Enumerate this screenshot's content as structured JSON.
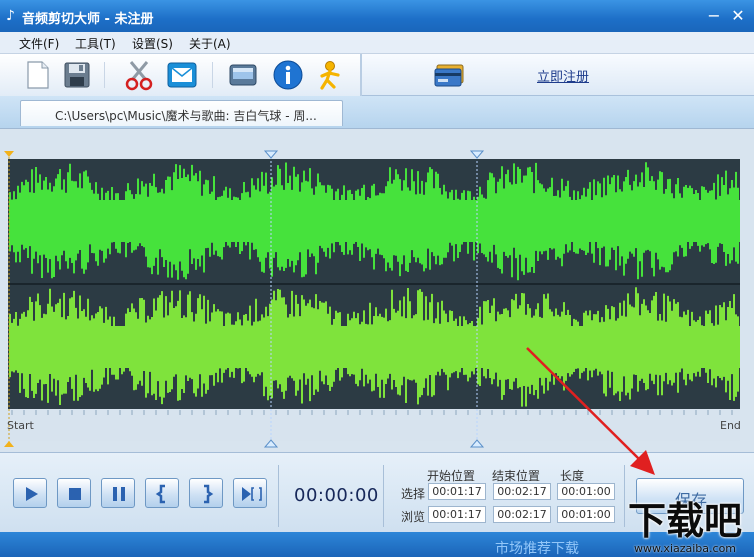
{
  "window": {
    "title": "音频剪切大师 - 未注册",
    "app_icon_glyph": "♪",
    "minimize_glyph": "−",
    "close_glyph": "✕"
  },
  "menu": {
    "items": [
      {
        "label": "文件(F)"
      },
      {
        "label": "工具(T)"
      },
      {
        "label": "设置(S)"
      },
      {
        "label": "关于(A)"
      }
    ]
  },
  "toolbar": {
    "icons": [
      "new-file-icon",
      "save-disk-icon",
      "scissors-icon",
      "mail-icon",
      "monitor-icon",
      "info-icon",
      "runner-icon"
    ],
    "register_label": "立即注册",
    "card_icon": "card-icon"
  },
  "file_tab": {
    "label": "C:\\Users\\pc\\Music\\魔术与歌曲: 吉白气球 - 周..."
  },
  "waveform": {
    "start_label": "Start",
    "end_label": "End",
    "wave_color_top": "#46e23c",
    "wave_color_bottom": "#7fe33c",
    "background_color": "#2c3b44",
    "markers": [
      "start-marker",
      "selection-start-marker",
      "selection-end-marker"
    ]
  },
  "playback": {
    "time": "00:00:00",
    "buttons": [
      "play-icon",
      "stop-icon",
      "pause-icon",
      "mark-start-icon",
      "mark-end-icon",
      "play-selection-icon"
    ]
  },
  "positions": {
    "headers": {
      "start": "开始位置",
      "end": "结束位置",
      "length": "长度"
    },
    "rows": [
      {
        "label": "选择",
        "start": "00:01:17",
        "end": "00:02:17",
        "length": "00:01:00"
      },
      {
        "label": "浏览",
        "start": "00:01:17",
        "end": "00:02:17",
        "length": "00:01:00"
      }
    ]
  },
  "save_button": {
    "label": "保存"
  },
  "watermark": {
    "title": "下载吧",
    "url": "www.xiazaiba.com"
  },
  "status": {
    "tail_text": "市场推荐下载"
  },
  "annotation": {
    "arrow_color": "#e02020"
  }
}
